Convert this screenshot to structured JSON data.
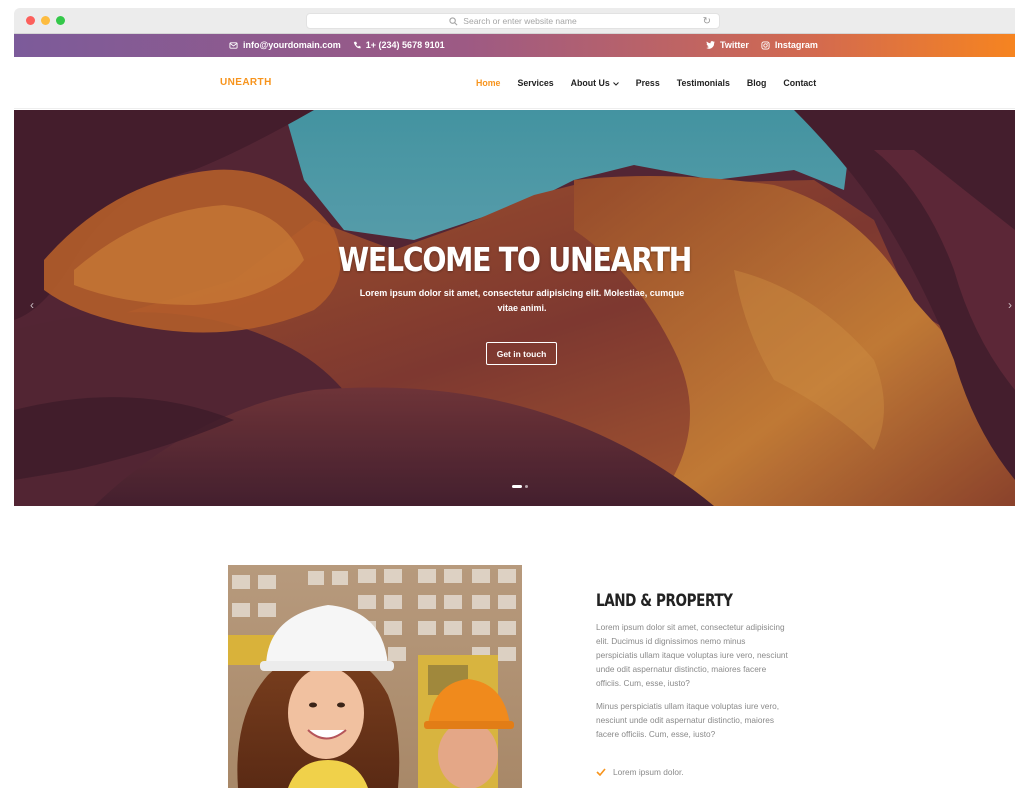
{
  "browser": {
    "url_placeholder": "Search or enter website name",
    "reload_icon": "reload-icon"
  },
  "topbar": {
    "email": "info@yourdomain.com",
    "phone": "1+ (234) 5678 9101",
    "twitter": "Twitter",
    "instagram": "Instagram",
    "gradient_start": "#7c5b9a",
    "gradient_end": "#f68420"
  },
  "nav": {
    "logo": "UNEARTH",
    "items": [
      {
        "label": "Home",
        "active": true
      },
      {
        "label": "Services"
      },
      {
        "label": "About Us",
        "dropdown": true
      },
      {
        "label": "Press"
      },
      {
        "label": "Testimonials"
      },
      {
        "label": "Blog"
      },
      {
        "label": "Contact"
      }
    ],
    "accent": "#f7941d"
  },
  "hero": {
    "title": "WELCOME TO UNEARTH",
    "subtitle": "Lorem ipsum dolor sit amet, consectetur adipisicing elit. Molestiae, cumque vitae animi.",
    "button": "Get in touch",
    "slides_total": 2,
    "active_slide": 1
  },
  "section": {
    "title": "LAND & PROPERTY",
    "paragraph1": "Lorem ipsum dolor sit amet, consectetur adipisicing elit. Ducimus id dignissimos nemo minus perspiciatis ullam itaque voluptas iure vero, nesciunt unde odit aspernatur distinctio, maiores facere officiis. Cum, esse, iusto?",
    "paragraph2": "Minus perspiciatis ullam itaque voluptas iure vero, nesciunt unde odit aspernatur distinctio, maiores facere officiis. Cum, esse, iusto?",
    "checklist": [
      "Lorem ipsum dolor."
    ]
  }
}
